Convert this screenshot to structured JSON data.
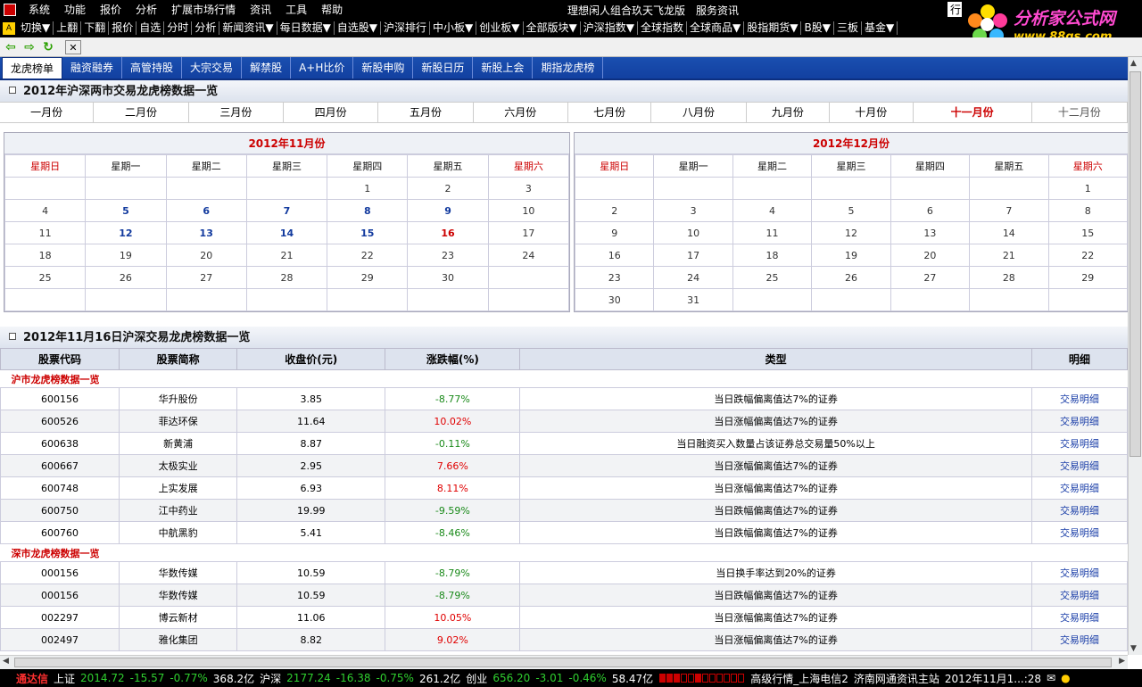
{
  "menubar": {
    "items": [
      "系统",
      "功能",
      "报价",
      "分析",
      "扩展市场行情",
      "资讯",
      "工具",
      "帮助"
    ],
    "title": "理想闲人组合玖天飞龙版",
    "service": "服务资讯",
    "box": "行"
  },
  "brand": {
    "line1": "分析家公式网",
    "line2": "www.88gs.com"
  },
  "toolbar": {
    "badge": "A",
    "items": [
      "切换▼",
      "上翻",
      "下翻",
      "报价",
      "自选",
      "分时",
      "分析",
      "新闻资讯▼",
      "每日数据▼",
      "自选股▼",
      "沪深排行",
      "中小板▼",
      "创业板▼",
      "全部版块▼",
      "沪深指数▼",
      "全球指数",
      "全球商品▼",
      "股指期货▼",
      "B股▼",
      "三板",
      "基金▼"
    ]
  },
  "tabs": [
    "龙虎榜单",
    "融资融券",
    "高管持股",
    "大宗交易",
    "解禁股",
    "A+H比价",
    "新股申购",
    "新股日历",
    "新股上会",
    "期指龙虎榜"
  ],
  "section1": {
    "title": "2012年沪深两市交易龙虎榜数据一览"
  },
  "months": [
    "一月份",
    "二月份",
    "三月份",
    "四月份",
    "五月份",
    "六月份",
    "七月份",
    "八月份",
    "九月份",
    "十月份",
    "十一月份",
    "十二月份"
  ],
  "weekdays": [
    "星期日",
    "星期一",
    "星期二",
    "星期三",
    "星期四",
    "星期五",
    "星期六"
  ],
  "cal_nov": {
    "title": "2012年11月份",
    "rows": [
      [
        "",
        "",
        "",
        "",
        "1",
        "2",
        "3"
      ],
      [
        "4",
        "5",
        "6",
        "7",
        "8",
        "9",
        "10"
      ],
      [
        "11",
        "12",
        "13",
        "14",
        "15",
        "16",
        "17"
      ],
      [
        "18",
        "19",
        "20",
        "21",
        "22",
        "23",
        "24"
      ],
      [
        "25",
        "26",
        "27",
        "28",
        "29",
        "30",
        ""
      ],
      [
        "",
        "",
        "",
        "",
        "",
        "",
        ""
      ]
    ],
    "bold_days": [
      "5",
      "6",
      "7",
      "8",
      "9",
      "12",
      "13",
      "14",
      "15"
    ],
    "selected_day": "16"
  },
  "cal_dec": {
    "title": "2012年12月份",
    "rows": [
      [
        "",
        "",
        "",
        "",
        "",
        "",
        "1"
      ],
      [
        "2",
        "3",
        "4",
        "5",
        "6",
        "7",
        "8"
      ],
      [
        "9",
        "10",
        "11",
        "12",
        "13",
        "14",
        "15"
      ],
      [
        "16",
        "17",
        "18",
        "19",
        "20",
        "21",
        "22"
      ],
      [
        "23",
        "24",
        "25",
        "26",
        "27",
        "28",
        "29"
      ],
      [
        "30",
        "31",
        "",
        "",
        "",
        "",
        ""
      ]
    ]
  },
  "section2": {
    "title": "2012年11月16日沪深交易龙虎榜数据一览"
  },
  "table": {
    "headers": [
      "股票代码",
      "股票简称",
      "收盘价(元)",
      "涨跌幅(%)",
      "类型",
      "明细"
    ],
    "groups": [
      {
        "label": "沪市龙虎榜数据一览",
        "rows": [
          {
            "code": "600156",
            "name": "华升股份",
            "close": "3.85",
            "chg": "-8.77%",
            "type": "当日跌幅偏离值达7%的证券",
            "detail": "交易明细"
          },
          {
            "code": "600526",
            "name": "菲达环保",
            "close": "11.64",
            "chg": "10.02%",
            "type": "当日涨幅偏离值达7%的证券",
            "detail": "交易明细"
          },
          {
            "code": "600638",
            "name": "新黄浦",
            "close": "8.87",
            "chg": "-0.11%",
            "type": "当日融资买入数量占该证券总交易量50%以上",
            "detail": "交易明细"
          },
          {
            "code": "600667",
            "name": "太极实业",
            "close": "2.95",
            "chg": "7.66%",
            "type": "当日涨幅偏离值达7%的证券",
            "detail": "交易明细"
          },
          {
            "code": "600748",
            "name": "上实发展",
            "close": "6.93",
            "chg": "8.11%",
            "type": "当日涨幅偏离值达7%的证券",
            "detail": "交易明细"
          },
          {
            "code": "600750",
            "name": "江中药业",
            "close": "19.99",
            "chg": "-9.59%",
            "type": "当日跌幅偏离值达7%的证券",
            "detail": "交易明细"
          },
          {
            "code": "600760",
            "name": "中航黑豹",
            "close": "5.41",
            "chg": "-8.46%",
            "type": "当日跌幅偏离值达7%的证券",
            "detail": "交易明细"
          }
        ]
      },
      {
        "label": "深市龙虎榜数据一览",
        "rows": [
          {
            "code": "000156",
            "name": "华数传媒",
            "close": "10.59",
            "chg": "-8.79%",
            "type": "当日换手率达到20%的证券",
            "detail": "交易明细"
          },
          {
            "code": "000156",
            "name": "华数传媒",
            "close": "10.59",
            "chg": "-8.79%",
            "type": "当日跌幅偏离值达7%的证券",
            "detail": "交易明细"
          },
          {
            "code": "002297",
            "name": "博云新材",
            "close": "11.06",
            "chg": "10.05%",
            "type": "当日涨幅偏离值达7%的证券",
            "detail": "交易明细"
          },
          {
            "code": "002497",
            "name": "雅化集团",
            "close": "8.82",
            "chg": "9.02%",
            "type": "当日涨幅偏离值达7%的证券",
            "detail": "交易明细"
          }
        ]
      }
    ]
  },
  "statusbar": {
    "brand": "通达信",
    "sh_label": "上证",
    "sh_val": "2014.72",
    "sh_chg": "-15.57",
    "sh_pct": "-0.77%",
    "sh_amt": "368.2亿",
    "hs_label": "沪深",
    "hs_val": "2177.24",
    "hs_chg": "-16.38",
    "hs_pct": "-0.75%",
    "hs_amt": "261.2亿",
    "cy_label": "创业",
    "cy_val": "656.20",
    "cy_chg": "-3.01",
    "cy_pct": "-0.46%",
    "cy_amt": "58.47亿",
    "feed": "高级行情_上海电信2",
    "site": "济南网通资讯主站",
    "time": "2012年11月1...:28"
  },
  "colors": {
    "up": "#e00000",
    "down": "#1a8a1a",
    "link": "#1a3ea8",
    "tab_blue": "#1a4fb0"
  }
}
